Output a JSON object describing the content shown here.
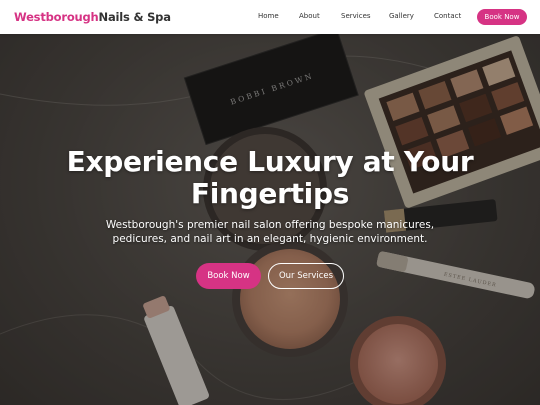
{
  "header": {
    "logo_part1": "Westborough",
    "logo_part2": "Nails & Spa",
    "nav": {
      "home": "Home",
      "about": "About",
      "services": "Services",
      "gallery": "Gallery",
      "contact": "Contact"
    },
    "cta": "Book Now"
  },
  "hero": {
    "title_line1": "Experience Luxury at Your",
    "title_line2": "Fingertips",
    "subtitle_line1": "Westborough's premier nail salon offering bespoke manicures,",
    "subtitle_line2": "pedicures, and nail art in an elegant, hygienic environment.",
    "primary_button": "Book Now",
    "secondary_button": "Our Services",
    "compact_brand_text": "BOBBI BROWN",
    "tube_brand_text": "ESTEE LAUDER"
  },
  "colors": {
    "accent": "#d63384",
    "text_dark": "#333333",
    "header_bg": "#ffffff"
  }
}
